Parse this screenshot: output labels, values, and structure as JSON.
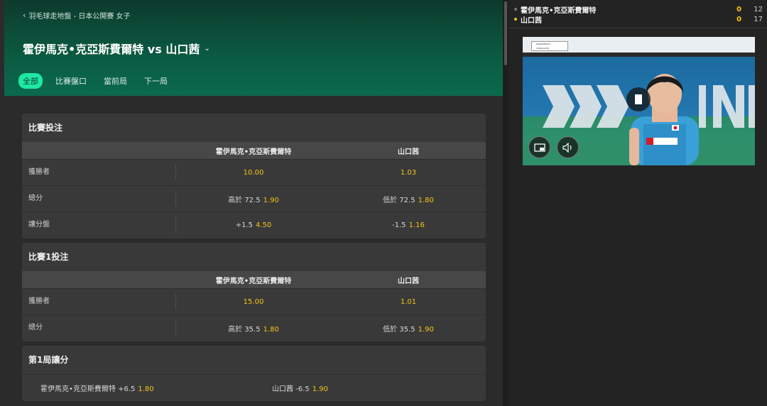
{
  "header": {
    "breadcrumb": "羽毛球走地盤 - 日本公開賽 女子",
    "match_title": "霍伊馬克•克亞斯費爾特 vs 山口茜",
    "tabs": [
      "全部",
      "比賽盤口",
      "當前局",
      "下一局"
    ]
  },
  "markets": {
    "match": {
      "title": "比賽投注",
      "team_a": "霍伊馬克•克亞斯費爾特",
      "team_b": "山口茜",
      "rows": [
        {
          "label": "獲勝者",
          "a_line": "",
          "a_odds": "10.00",
          "b_line": "",
          "b_odds": "1.03"
        },
        {
          "label": "總分",
          "a_line": "高於 72.5",
          "a_odds": "1.90",
          "b_line": "低於 72.5",
          "b_odds": "1.80"
        },
        {
          "label": "讓分盤",
          "a_line": "+1.5",
          "a_odds": "4.50",
          "b_line": "-1.5",
          "b_odds": "1.16"
        }
      ]
    },
    "game1": {
      "title": "比賽1投注",
      "team_a": "霍伊馬克•克亞斯費爾特",
      "team_b": "山口茜",
      "rows": [
        {
          "label": "獲勝者",
          "a_line": "",
          "a_odds": "15.00",
          "b_line": "",
          "b_odds": "1.01"
        },
        {
          "label": "總分",
          "a_line": "高於 35.5",
          "a_odds": "1.80",
          "b_line": "低於 35.5",
          "b_odds": "1.90"
        }
      ]
    },
    "game1_handicap": {
      "title": "第1局讓分",
      "a_text": "霍伊馬克•克亞斯費爾特 +6.5",
      "a_odds": "1.80",
      "b_text": "山口茜 -6.5",
      "b_odds": "1.90"
    }
  },
  "scoreboard": {
    "players": [
      {
        "name": "霍伊馬克•克亞斯費爾特",
        "sets": "0",
        "points": "12",
        "serving": false
      },
      {
        "name": "山口茜",
        "sets": "0",
        "points": "17",
        "serving": true
      }
    ]
  },
  "video": {
    "scorebug_lines": [
      "KJAERSFELDT",
      "YAMAGUCHI"
    ]
  },
  "colors": {
    "accent": "#1de9a5",
    "odds": "#f5c518",
    "hero_top": "#0c3a2c",
    "hero_bottom": "#0a6a4c"
  }
}
